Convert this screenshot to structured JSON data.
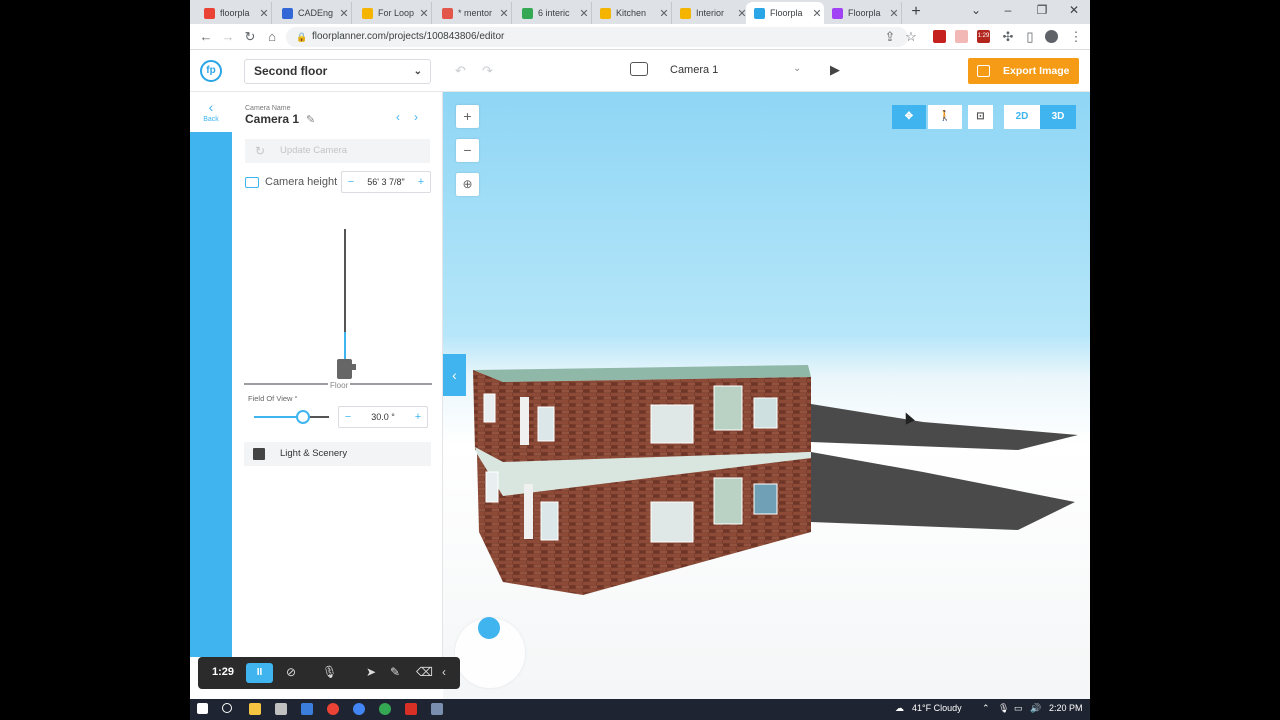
{
  "browser": {
    "tabs": [
      {
        "title": "floorpla",
        "color": "#ea4335"
      },
      {
        "title": "CADEng",
        "color": "#3367d6"
      },
      {
        "title": "For Loop",
        "color": "#f5b400"
      },
      {
        "title": "* mentor",
        "color": "#e3574b"
      },
      {
        "title": "6 interic",
        "color": "#34a853"
      },
      {
        "title": "Kitchen",
        "color": "#f5b400"
      },
      {
        "title": "Interior",
        "color": "#f5b400"
      },
      {
        "title": "Floorpla",
        "color": "#2aa5e6"
      },
      {
        "title": "Floorpla",
        "color": "#a142f4"
      }
    ],
    "new_tab": "+",
    "url": "floorplanner.com/projects/100843806/editor",
    "badge": "1:29"
  },
  "header": {
    "floor_select": "Second floor",
    "camera_label": "Camera 1",
    "export_label": "Export Image",
    "accent": "#f59b16"
  },
  "rail": {
    "back_label": "Back"
  },
  "panel": {
    "camera_name_label": "Camera Name",
    "camera_name": "Camera 1",
    "update_camera": "Update Camera",
    "camera_height_label": "Camera height",
    "camera_height_value": "56' 3 7/8\"",
    "floor_label": "Floor",
    "fov_label": "Field Of View °",
    "fov_value": "30.0 °",
    "light_scenery": "Light & Scenery"
  },
  "viewport": {
    "mode_2d": "2D",
    "mode_3d": "3D",
    "zoom_in": "+",
    "zoom_out": "−",
    "brand_color": "#3fb4ef"
  },
  "recorder": {
    "time": "1:29",
    "pause": "II"
  },
  "taskbar": {
    "weather": "41°F  Cloudy",
    "clock": "2:20 PM"
  }
}
